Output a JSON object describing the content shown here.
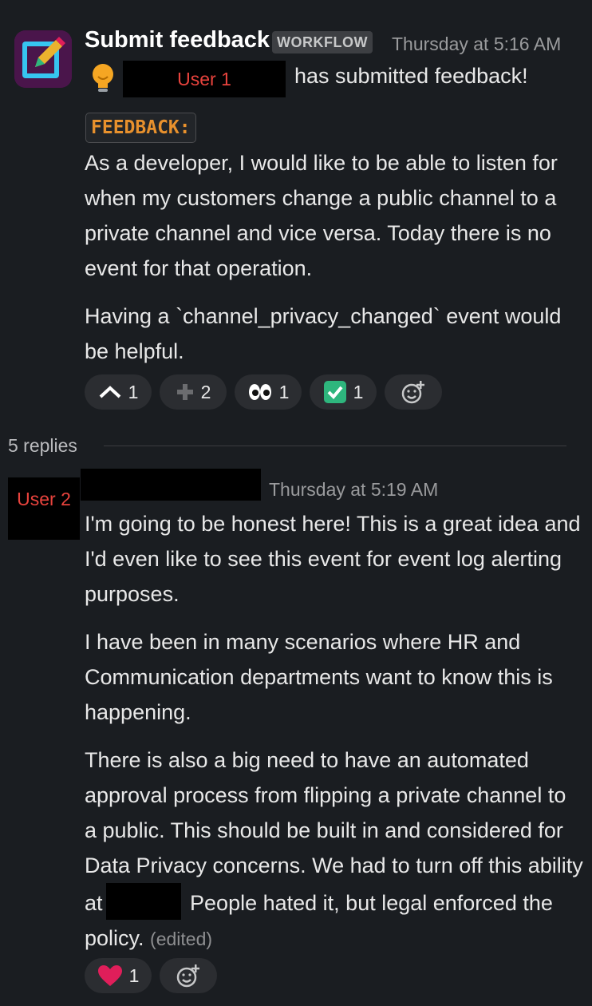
{
  "message": {
    "app_name": "Submit feedback",
    "badge": "WORKFLOW",
    "timestamp": "Thursday at 5:16 AM",
    "user_placeholder": "User 1",
    "submitted_text": "has submitted feedback!",
    "code_label": "FEEDBACK:",
    "paragraph1": "As a developer, I would like to be able to listen for when my customers change a public channel to a private channel and vice versa. Today there is no event for that operation.",
    "paragraph2": "Having a `channel_privacy_changed` event would be helpful.",
    "reactions": [
      {
        "icon": "upvote-caret-icon",
        "count": "1"
      },
      {
        "icon": "plus-icon",
        "count": "2"
      },
      {
        "icon": "eyes-icon",
        "count": "1"
      },
      {
        "icon": "check-mark-icon",
        "count": "1"
      }
    ]
  },
  "thread": {
    "replies_label": "5 replies"
  },
  "reply": {
    "user_placeholder": "User 2",
    "timestamp": "Thursday at 5:19 AM",
    "paragraph1": "I'm going to be honest here! This is a great idea and I'd even like to see this event for event log alerting purposes.",
    "paragraph2": "I have been in many scenarios where HR and Communication departments want to know this is happening.",
    "paragraph3_part1": "There is also a big need to have an automated approval process from flipping a private channel to a public. This should be built in and considered for Data Privacy concerns. We had to turn off this ability at",
    "paragraph3_part2": " People hated it, but legal enforced the policy.",
    "edited": "(edited)",
    "reactions": [
      {
        "icon": "heart-icon",
        "count": "1"
      }
    ]
  },
  "colors": {
    "background": "#1a1d21",
    "text": "#e8e8e8",
    "muted": "#9a9b9d",
    "code_orange": "#e8912d",
    "redacted_label": "#e8433d"
  }
}
